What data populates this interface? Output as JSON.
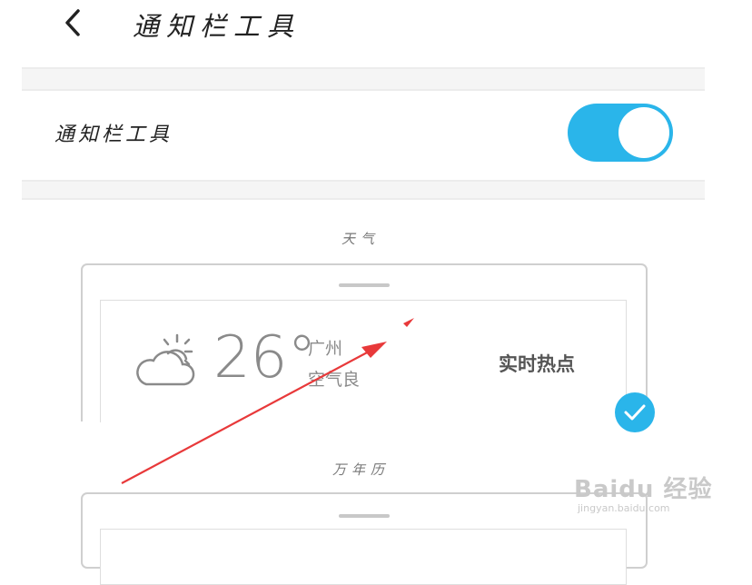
{
  "header": {
    "title": "通知栏工具",
    "back_icon": "chevron-left-icon"
  },
  "setting": {
    "label": "通知栏工具",
    "enabled": true,
    "toggle_color": "#2ab5ea"
  },
  "sections": [
    {
      "caption": "天气",
      "preview": {
        "weather_icon": "partly-cloudy-sun-icon",
        "temperature": "26°",
        "city": "广州",
        "air_quality": "空气良",
        "hot_label": "实时热点"
      },
      "selected": true,
      "check_icon": "check-icon"
    },
    {
      "caption": "万年历"
    }
  ],
  "watermark": {
    "main": "Baidu 经验",
    "sub": "jingyan.baidu.com"
  },
  "annotation_color": "#e8393a"
}
